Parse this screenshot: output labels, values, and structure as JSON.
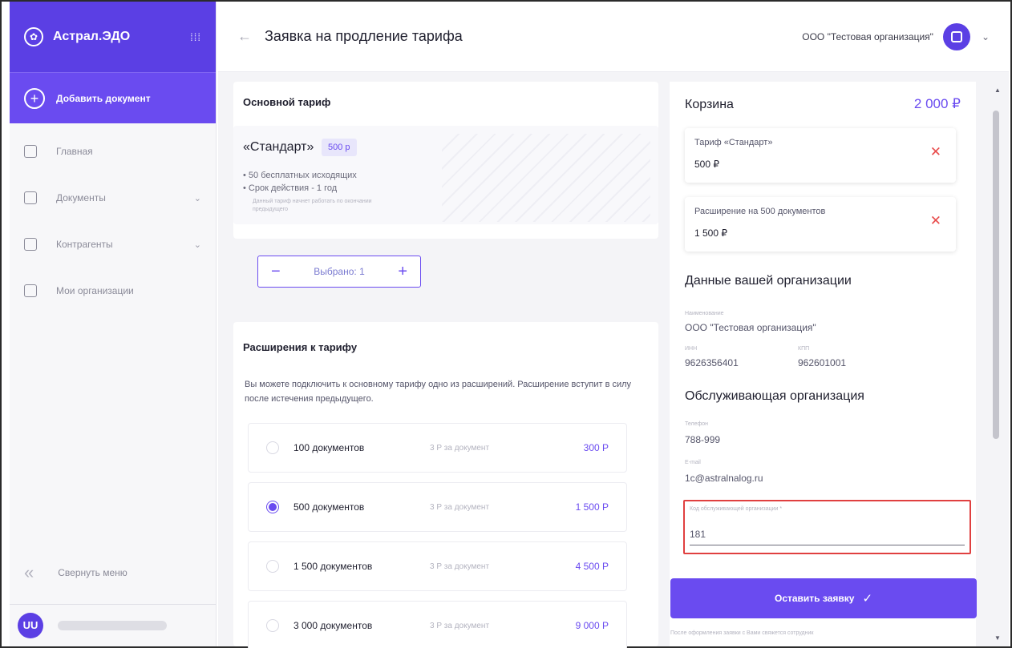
{
  "sidebar": {
    "brand": "Астрал.ЭДО",
    "grid_icon": "grid-icon",
    "add_document": "Добавить документ",
    "items": [
      {
        "label": "Главная",
        "icon": "home-icon"
      },
      {
        "label": "Документы",
        "icon": "mail-icon"
      },
      {
        "label": "Контрагенты",
        "icon": "contacts-icon"
      },
      {
        "label": "Мои организации",
        "icon": "building-icon"
      }
    ],
    "collapse": "Свернуть меню",
    "user_initials": "UU"
  },
  "header": {
    "title": "Заявка на продление тарифа",
    "org": "ООО \"Тестовая организация\""
  },
  "main": {
    "base_title": "Основной тариф",
    "tariff_name": "«Стандарт»",
    "tariff_price": "500 р",
    "tariff_bullets": [
      "50 бесплатных исходящих",
      "Срок действия - 1 год"
    ],
    "tariff_note": "Данный тариф начнет работать по окончании предыдущего",
    "stepper_label": "Выбрано: 1",
    "ext_title": "Расширения к тарифу",
    "ext_text": "Вы можете подключить к основному тарифу одно из расширений. Расширение вступит в силу после истечения предыдущего.",
    "options": [
      {
        "name": "100 документов",
        "unit": "3 Р за документ",
        "price": "300 Р",
        "selected": false
      },
      {
        "name": "500 документов",
        "unit": "3 Р за документ",
        "price": "1 500 Р",
        "selected": true
      },
      {
        "name": "1 500 документов",
        "unit": "3 Р за документ",
        "price": "4 500 Р",
        "selected": false
      },
      {
        "name": "3 000 документов",
        "unit": "3 Р за документ",
        "price": "9 000 Р",
        "selected": false
      }
    ]
  },
  "cart": {
    "title": "Корзина",
    "total": "2 000 ₽",
    "items": [
      {
        "name": "Тариф «Стандарт»",
        "price": "500 ₽"
      },
      {
        "name": "Расширение на 500 документов",
        "price": "1 500 ₽"
      }
    ],
    "org_block": {
      "title": "Данные вашей организации",
      "name_label": "Наименование",
      "name": "ООО \"Тестовая организация\"",
      "inn_label": "ИНН",
      "inn": "9626356401",
      "kpp_label": "КПП",
      "kpp": "962601001"
    },
    "service_block": {
      "title": "Обслуживающая организация",
      "phone_label": "Телефон",
      "phone": "788-999",
      "email_label": "E-mail",
      "email": "1c@astralnalog.ru",
      "code_label": "Код обслуживающей организации *",
      "code": "181"
    },
    "submit": "Оставить заявку",
    "footnote": "После оформления заявки с Вами свяжется сотрудник"
  },
  "colors": {
    "accent": "#6a4bf0",
    "sidebar_head": "#5b3fe4",
    "danger": "#e04040"
  }
}
